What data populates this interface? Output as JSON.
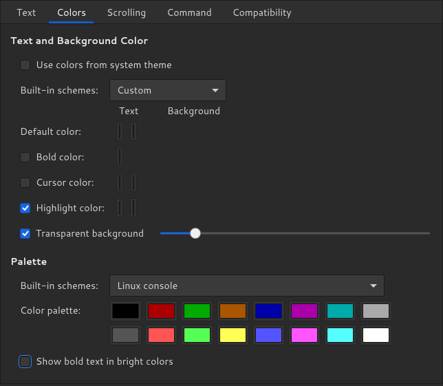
{
  "tabs": {
    "text": "Text",
    "colors": "Colors",
    "scrolling": "Scrolling",
    "command": "Command",
    "compatibility": "Compatibility",
    "active": "colors"
  },
  "section_text_bg": "Text and Background Color",
  "use_system_colors": {
    "label": "Use colors from system theme",
    "checked": false
  },
  "builtin_schemes_label": "Built-in schemes:",
  "color_scheme_value": "Custom",
  "columns": {
    "text": "Text",
    "background": "Background"
  },
  "default_color": {
    "label": "Default color:",
    "text": "#ff0000",
    "background": "#1f1f33"
  },
  "bold_color": {
    "label": "Bold color:",
    "checked": false,
    "text": "#2c2c2c"
  },
  "cursor_color": {
    "label": "Cursor color:",
    "checked": false,
    "text": "#7a4848",
    "background": "#2c2c2c"
  },
  "highlight_color": {
    "label": "Highlight color:",
    "checked": true,
    "text": "#ffffff",
    "background": "#000000"
  },
  "transparent_bg": {
    "label": "Transparent background",
    "checked": true,
    "value": 13
  },
  "section_palette": "Palette",
  "palette_scheme_value": "Linux console",
  "color_palette_label": "Color palette:",
  "palette": [
    "#000000",
    "#aa0000",
    "#00aa00",
    "#aa5500",
    "#0000aa",
    "#aa00aa",
    "#00aaaa",
    "#aaaaaa",
    "#555555",
    "#ff5555",
    "#55ff55",
    "#ffff55",
    "#5555ff",
    "#ff55ff",
    "#55ffff",
    "#ffffff"
  ],
  "show_bold_bright": {
    "label": "Show bold text in bright colors",
    "checked": false
  }
}
